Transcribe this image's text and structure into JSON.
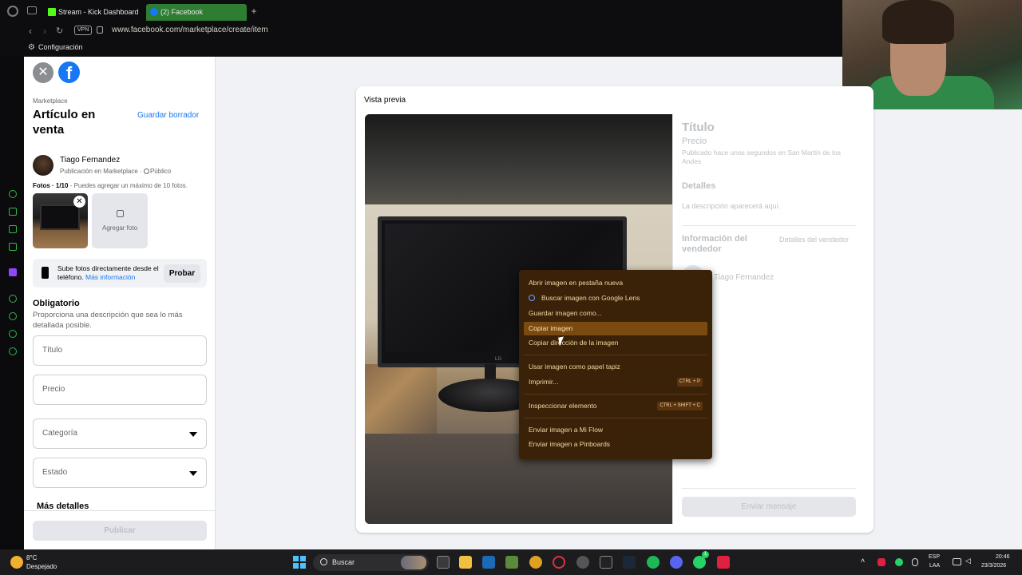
{
  "browser": {
    "tabs": [
      {
        "label": "Stream - Kick Dashboard"
      },
      {
        "label": "(2) Facebook"
      }
    ],
    "vpn_label": "VPN",
    "url": "www.facebook.com/marketplace/create/item",
    "bookmark_label": "Configuración"
  },
  "sidebar_opera": {
    "gx_label": "GX",
    "more_label": "···"
  },
  "fb_left": {
    "breadcrumb": "Marketplace",
    "title": "Artículo en venta",
    "save_draft": "Guardar borrador",
    "user_name": "Tiago Fernandez",
    "user_sub": "Publicación en Marketplace ·",
    "audience": "Público",
    "photos_count": "Fotos · 1/10",
    "photos_hint": " - Puedes agregar un máximo de 10 fotos.",
    "add_photo": "Agregar foto",
    "tip_text": "Sube fotos directamente desde el teléfono.",
    "tip_link": "Más información",
    "try_button": "Probar",
    "required_heading": "Obligatorio",
    "required_desc": "Proporciona una descripción que sea lo más detallada posible.",
    "field_title": "Título",
    "field_price": "Precio",
    "field_category": "Categoría",
    "field_condition": "Estado",
    "more_details": "Más detalles",
    "publish_button": "Publicar"
  },
  "preview": {
    "card_title": "Vista previa",
    "monitor_brand": "LG",
    "title": "Título",
    "price": "Precio",
    "published": "Publicado hace unos segundos en San Martín de los Andes",
    "details_heading": "Detalles",
    "description_placeholder": "La descripción aparecerá aquí.",
    "seller_heading": "Información del vendedor",
    "seller_details_link": "Detalles del vendedor",
    "seller_name": "Tiago Fernandez",
    "send_message": "Enviar mensaje"
  },
  "context_menu": {
    "items": [
      {
        "label": "Abrir imagen en pestaña nueva"
      },
      {
        "label": "Buscar imagen con Google Lens"
      },
      {
        "label": "Guardar imagen como..."
      },
      {
        "label": "Copiar imagen"
      },
      {
        "label": "Copiar dirección de la imagen"
      },
      {
        "label": "Usar imagen como papel tapiz"
      },
      {
        "label": "Imprimir...",
        "shortcut": "CTRL + P"
      },
      {
        "label": "Inspeccionar elemento",
        "shortcut": "CTRL + SHIFT + C"
      },
      {
        "label": "Enviar imagen a Mi Flow"
      },
      {
        "label": "Enviar imagen a Pinboards"
      }
    ],
    "highlighted_item": "Copiar imagen"
  },
  "taskbar": {
    "temperature": "8°C",
    "weather": "Despejado",
    "search_label": "Buscar",
    "language": "ESP",
    "layout": "LAA",
    "time": "20:46",
    "date": "23/3/2026",
    "whatsapp_badge": "1"
  },
  "colors": {
    "facebook_blue": "#1877f2",
    "active_tab": "#2e7d32",
    "context_menu_bg": "#3a2208",
    "context_menu_highlight": "#7a4a10",
    "opera_gx_green": "#2fb84a"
  }
}
